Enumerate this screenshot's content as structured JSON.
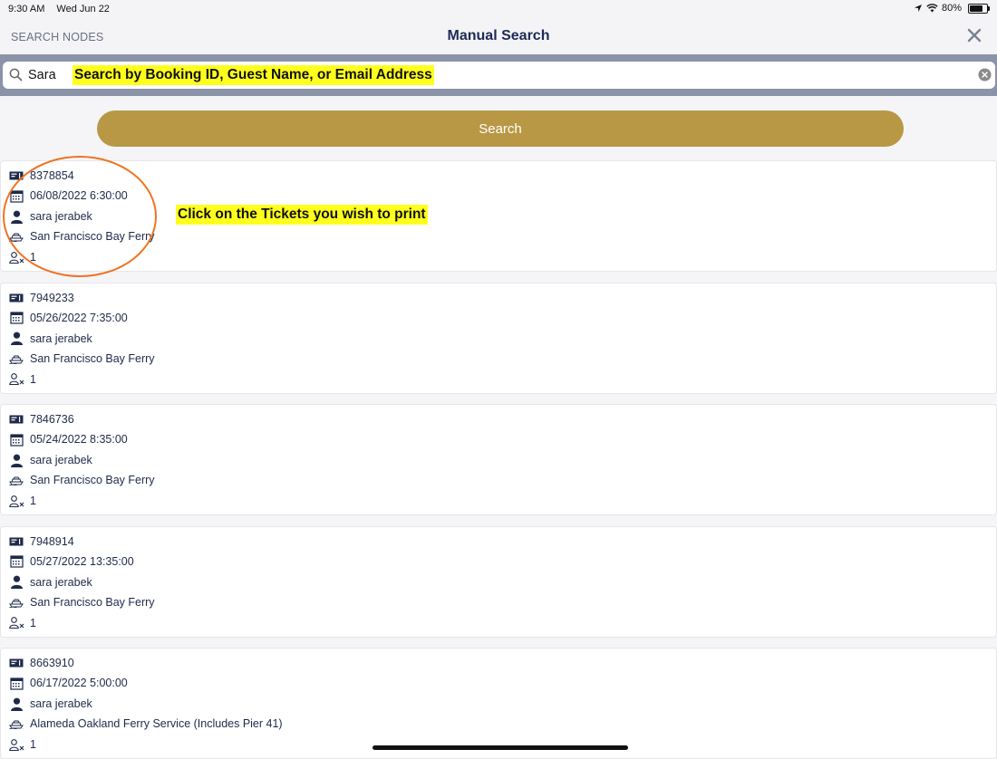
{
  "status_bar": {
    "time": "9:30 AM",
    "date": "Wed Jun 22",
    "battery": "80%",
    "battery_level": 0.8
  },
  "nav": {
    "left_label": "SEARCH NODES",
    "title": "Manual Search"
  },
  "search": {
    "value": "Sara",
    "annotation": "Search by Booking ID, Guest Name, or Email Address"
  },
  "search_button": {
    "label": "Search"
  },
  "annotation_tickets": "Click on the Tickets you wish to print",
  "colors": {
    "accent_gold": "#b89844",
    "navy": "#1c2a55",
    "highlight": "#ffff1e",
    "circle": "#ee7423",
    "search_strip": "#8a93a8"
  },
  "icons": {
    "booking": "ticket-icon",
    "date": "calendar-icon",
    "guest": "person-icon",
    "route": "ferry-icon",
    "passengers": "passenger-count-icon"
  },
  "results": [
    {
      "booking_id": "8378854",
      "datetime": "06/08/2022 6:30:00",
      "guest": "sara jerabek",
      "route": "San Francisco Bay Ferry",
      "passengers": "1"
    },
    {
      "booking_id": "7949233",
      "datetime": "05/26/2022 7:35:00",
      "guest": "sara jerabek",
      "route": "San Francisco Bay Ferry",
      "passengers": "1"
    },
    {
      "booking_id": "7846736",
      "datetime": "05/24/2022 8:35:00",
      "guest": "sara jerabek",
      "route": "San Francisco Bay Ferry",
      "passengers": "1"
    },
    {
      "booking_id": "7948914",
      "datetime": "05/27/2022 13:35:00",
      "guest": "sara jerabek",
      "route": "San Francisco Bay Ferry",
      "passengers": "1"
    },
    {
      "booking_id": "8663910",
      "datetime": "06/17/2022 5:00:00",
      "guest": "sara jerabek",
      "route": "Alameda Oakland Ferry Service (Includes Pier 41)",
      "passengers": "1"
    }
  ]
}
